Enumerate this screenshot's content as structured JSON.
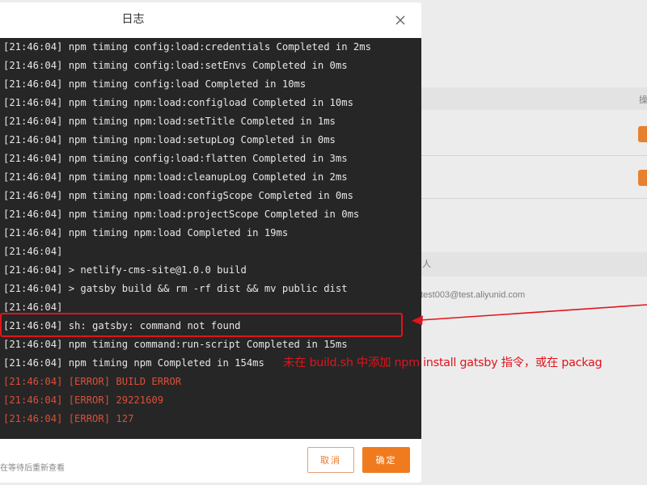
{
  "background": {
    "col_header": "操",
    "col_header2": "人",
    "email": "test003@test.aliyunid.com"
  },
  "modal": {
    "title": "日志",
    "close_icon": "close-icon",
    "log_lines": [
      {
        "text": "[21:46:04] npm timing config:load:credentials Completed in 2ms",
        "level": "info"
      },
      {
        "text": "[21:46:04] npm timing config:load:setEnvs Completed in 0ms",
        "level": "info"
      },
      {
        "text": "[21:46:04] npm timing config:load Completed in 10ms",
        "level": "info"
      },
      {
        "text": "[21:46:04] npm timing npm:load:configload Completed in 10ms",
        "level": "info"
      },
      {
        "text": "[21:46:04] npm timing npm:load:setTitle Completed in 1ms",
        "level": "info"
      },
      {
        "text": "[21:46:04] npm timing npm:load:setupLog Completed in 0ms",
        "level": "info"
      },
      {
        "text": "[21:46:04] npm timing config:load:flatten Completed in 3ms",
        "level": "info"
      },
      {
        "text": "[21:46:04] npm timing npm:load:cleanupLog Completed in 2ms",
        "level": "info"
      },
      {
        "text": "[21:46:04] npm timing npm:load:configScope Completed in 0ms",
        "level": "info"
      },
      {
        "text": "[21:46:04] npm timing npm:load:projectScope Completed in 0ms",
        "level": "info"
      },
      {
        "text": "[21:46:04] npm timing npm:load Completed in 19ms",
        "level": "info"
      },
      {
        "text": "[21:46:04]",
        "level": "info"
      },
      {
        "text": "[21:46:04] > netlify-cms-site@1.0.0 build",
        "level": "info"
      },
      {
        "text": "[21:46:04] > gatsby build && rm -rf dist && mv public dist",
        "level": "info"
      },
      {
        "text": "[21:46:04]",
        "level": "info"
      },
      {
        "text": "[21:46:04] sh: gatsby: command not found",
        "level": "info"
      },
      {
        "text": "[21:46:04] npm timing command:run-script Completed in 15ms",
        "level": "info"
      },
      {
        "text": "[21:46:04] npm timing npm Completed in 154ms",
        "level": "info"
      },
      {
        "text": "[21:46:04] [ERROR] BUILD ERROR",
        "level": "error"
      },
      {
        "text": "[21:46:04] [ERROR] 29221609",
        "level": "error"
      },
      {
        "text": "[21:46:04] [ERROR] 127",
        "level": "error"
      }
    ],
    "footer_hint": "在等待后重新查看",
    "cancel_label": "取消",
    "ok_label": "确定"
  },
  "annotation": {
    "text": "未在 build.sh 中添加 npm install gatsby 指令，或在 packag",
    "color": "#e0141c"
  },
  "colors": {
    "terminal_bg": "#262626",
    "error_text": "#d9503a",
    "accent": "#f07b1f",
    "annotation": "#e0141c"
  }
}
